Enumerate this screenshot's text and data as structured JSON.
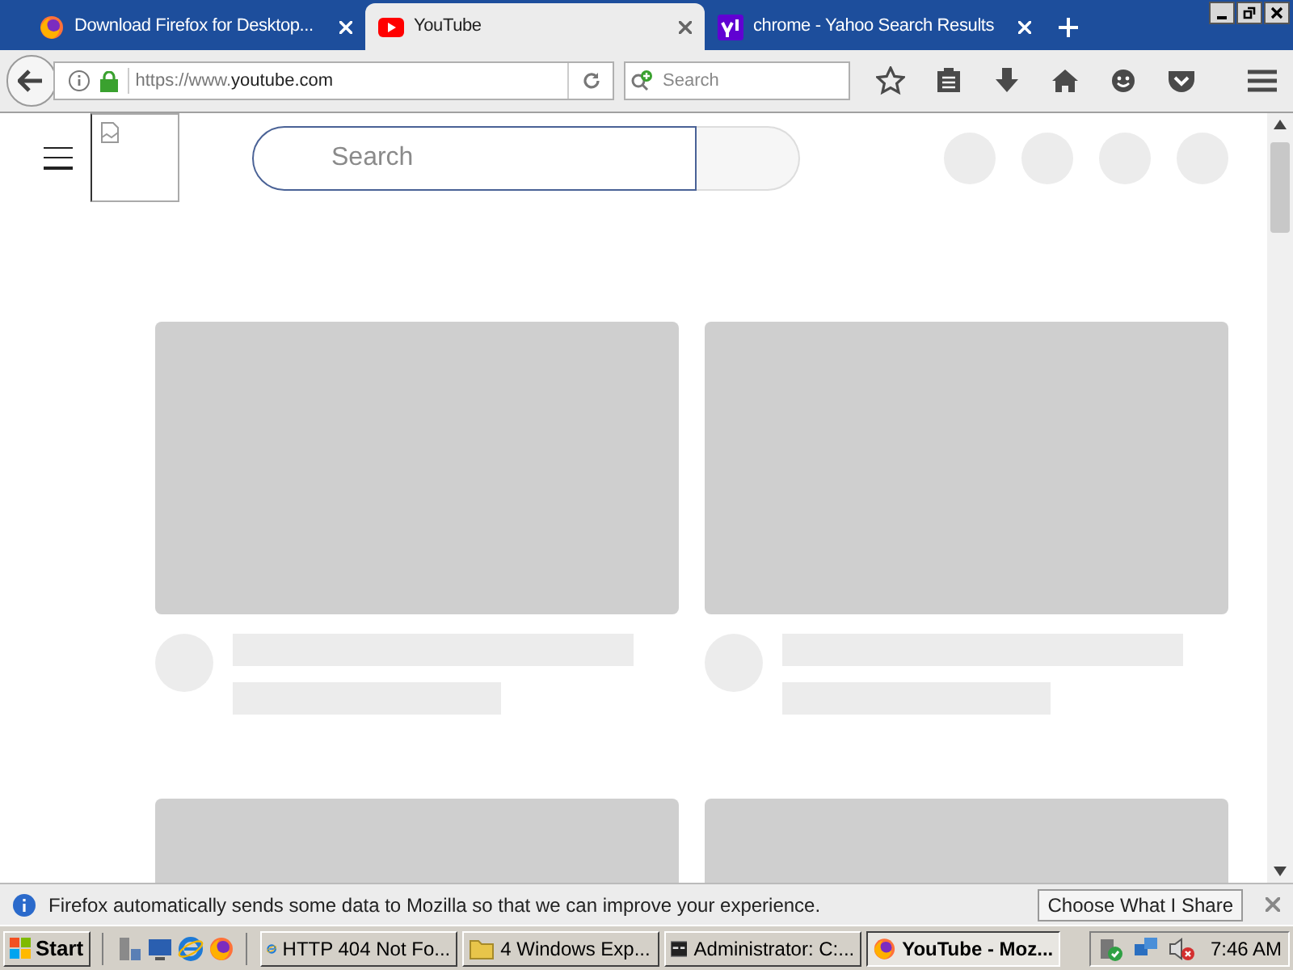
{
  "browser": {
    "tabs": [
      {
        "label": "Download Firefox for Desktop...",
        "kind": "firefox",
        "selected": false
      },
      {
        "label": "YouTube",
        "kind": "youtube",
        "selected": true
      },
      {
        "label": "chrome - Yahoo Search Results",
        "kind": "yahoo",
        "selected": false
      }
    ],
    "url_prefix": "https://www.",
    "url_domain": "youtube.com",
    "search_placeholder": "Search"
  },
  "page": {
    "search_placeholder": "Search",
    "video_cards": [
      {
        "kind": "placeholder"
      },
      {
        "kind": "placeholder"
      },
      {
        "kind": "thumbnail_only"
      },
      {
        "kind": "thumbnail_only"
      }
    ]
  },
  "notification": {
    "message": "Firefox automatically sends some data to Mozilla so that we can improve your experience.",
    "button": "Choose What I Share"
  },
  "taskbar": {
    "start": "Start",
    "buttons": [
      {
        "label": "HTTP 404 Not Fo...",
        "kind": "ie",
        "selected": false
      },
      {
        "label": "4 Windows Exp...",
        "kind": "folder",
        "selected": false
      },
      {
        "label": "Administrator: C:...",
        "kind": "console",
        "selected": false
      },
      {
        "label": "YouTube - Moz...",
        "kind": "firefox",
        "selected": true
      }
    ],
    "clock": "7:46 AM"
  }
}
